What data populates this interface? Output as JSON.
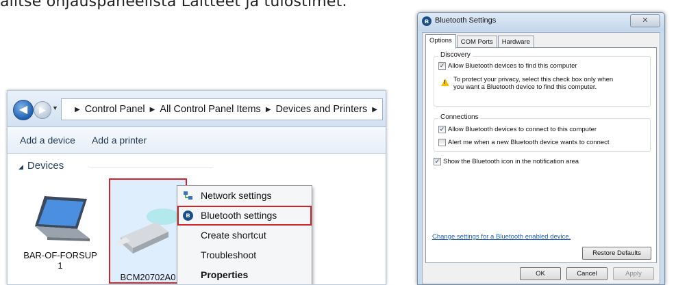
{
  "instruction": "alitse ohjauspaneelista Laitteet ja tulostimet.",
  "explorer": {
    "breadcrumb": [
      "Control Panel",
      "All Control Panel Items",
      "Devices and Printers"
    ],
    "toolbar": {
      "add_device": "Add a device",
      "add_printer": "Add a printer"
    },
    "group_header": "Devices",
    "devices": [
      {
        "label_line1": "BAR-OF-FORSUP",
        "label_line2": "1"
      },
      {
        "label_line1": "BCM20702A0",
        "label_line2": ""
      }
    ],
    "context_menu": [
      {
        "label": "Network settings",
        "icon": "network-icon"
      },
      {
        "label": "Bluetooth settings",
        "icon": "bluetooth-icon",
        "highlighted": true
      },
      {
        "label": "Create shortcut"
      },
      {
        "label": "Troubleshoot"
      },
      {
        "label": "Properties",
        "bold": true
      }
    ]
  },
  "dialog": {
    "title": "Bluetooth Settings",
    "tabs": [
      "Options",
      "COM Ports",
      "Hardware"
    ],
    "active_tab": "Options",
    "discovery": {
      "label": "Discovery",
      "allow_find": {
        "label": "Allow Bluetooth devices to find this computer",
        "checked": true
      },
      "warning_line1": "To protect your privacy, select this check box only when",
      "warning_line2": "you want a Bluetooth device to find this computer."
    },
    "connections": {
      "label": "Connections",
      "allow_connect": {
        "label": "Allow Bluetooth devices to connect to this computer",
        "checked": true
      },
      "alert_new": {
        "label": "Alert me when a new Bluetooth device wants to connect",
        "checked": false
      }
    },
    "show_icon": {
      "label": "Show the Bluetooth icon in the notification area",
      "checked": true
    },
    "link": "Change settings for a Bluetooth enabled device.",
    "buttons": {
      "restore": "Restore Defaults",
      "ok": "OK",
      "cancel": "Cancel",
      "apply": "Apply"
    },
    "check_glyph": "✓"
  },
  "colors": {
    "highlight_red": "#d1232a",
    "link_blue": "#1a5fb4"
  }
}
